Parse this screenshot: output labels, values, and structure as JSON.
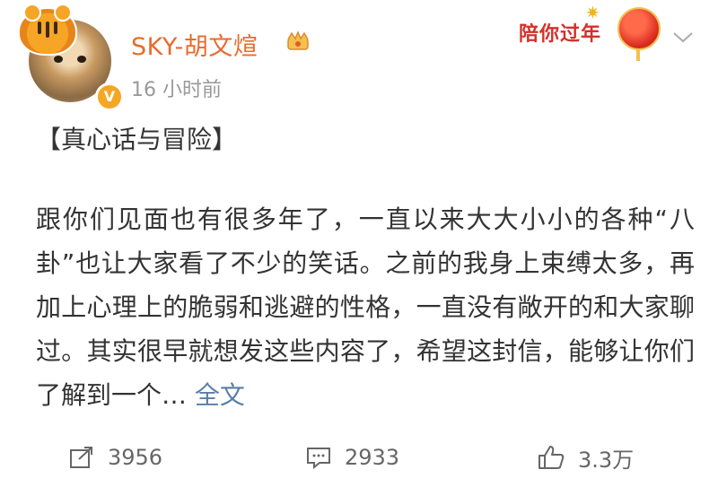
{
  "post": {
    "author": "SKY-胡文煊",
    "time": "16 小时前",
    "headline": "【真心话与冒险】",
    "body": "跟你们见面也有很多年了，一直以来大大小小的各种“八卦”也让大家看了不少的笑话。之前的我身上束缚太多，再加上心理上的脆弱和逃避的性格，一直没有敞开的和大家聊过。其实很早就想发这些内容了，希望这封信，能够让你们了解到一个…",
    "more_label": "全文"
  },
  "promo": {
    "text": "陪你过年"
  },
  "actions": {
    "repost_count": "3956",
    "comment_count": "2933",
    "like_count": "3.3万"
  },
  "icons": {
    "verified": "verified-badge-icon",
    "crown": "crown-icon",
    "repost": "repost-icon",
    "comment": "comment-icon",
    "like": "thumbs-up-icon",
    "chevron": "chevron-down-icon"
  },
  "colors": {
    "username": "#e86b2c",
    "link": "#5b7ea6",
    "promo": "#d4312a"
  }
}
